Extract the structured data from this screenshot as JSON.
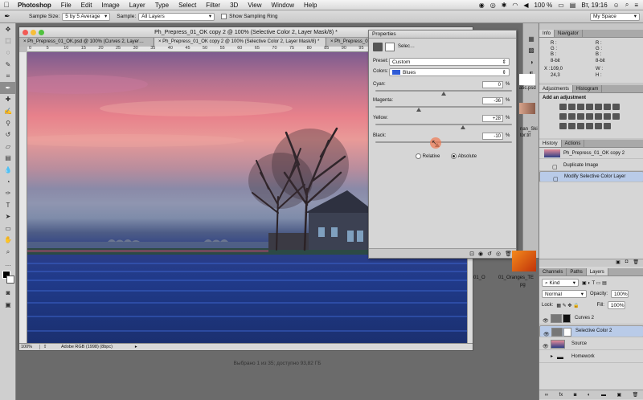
{
  "menubar": {
    "apple": "",
    "items": [
      "Photoshop",
      "File",
      "Edit",
      "Image",
      "Layer",
      "Type",
      "Select",
      "Filter",
      "3D",
      "View",
      "Window",
      "Help"
    ],
    "battery": "100 %",
    "clock": "Вт, 19:16"
  },
  "options": {
    "sample_size_label": "Sample Size:",
    "sample_size_value": "5 by 5 Average",
    "sample_label": "Sample:",
    "sample_value": "All Layers",
    "show_ring": "Show Sampling Ring",
    "workspace": "My Space"
  },
  "document": {
    "title": "Ph_Prepress_01_OK copy 2 @ 100% (Selective Color 2, Layer Mask/8) *",
    "tabs": [
      "Ph_Prepress_01_OK.psd @ 100% (Curves 2, Layer…",
      "Ph_Prepress_01_OK copy 2 @ 100% (Selective Color 2, Layer Mask/8) *",
      "Ph_Prepress_01_OK copy @ 100% (Layer/8)"
    ],
    "ruler_labels": [
      "0",
      "5",
      "10",
      "15",
      "20",
      "25",
      "30",
      "35",
      "40",
      "45",
      "50",
      "55",
      "60",
      "65",
      "70",
      "75",
      "80",
      "85",
      "90",
      "95",
      "100",
      "105",
      "110",
      "115",
      "120",
      "125"
    ],
    "zoom": "100%",
    "profile": "Adobe RGB (1998) (8bpc)"
  },
  "properties": {
    "title": "Properties",
    "panel_name": "Selec…",
    "preset_label": "Preset:",
    "preset_value": "Custom",
    "colors_label": "Colors:",
    "colors_value": "Blues",
    "colors_swatch": "#2f5bd6",
    "sliders": [
      {
        "label": "Cyan:",
        "value": "0",
        "pct": "%",
        "level": 0.5
      },
      {
        "label": "Magenta:",
        "value": "-36",
        "pct": "%",
        "level": 0.32
      },
      {
        "label": "Yellow:",
        "value": "+28",
        "pct": "%",
        "level": 0.64
      },
      {
        "label": "Black:",
        "value": "-10",
        "pct": "%",
        "level": 0.45
      }
    ],
    "relative": "Relative",
    "absolute": "Absolute",
    "method_selected": "Absolute"
  },
  "info_panel": {
    "tabs": [
      "Info",
      "Navigator"
    ],
    "r": "R :",
    "g": "G :",
    "b": "B :",
    "bits": "8-bit",
    "x": "X :",
    "x_value": "109,0",
    "y_value": "24,3",
    "w": "W :",
    "h": "H :"
  },
  "adjustments": {
    "tabs": [
      "Adjustments",
      "Histogram"
    ],
    "heading": "Add an adjustment"
  },
  "history": {
    "tabs": [
      "History",
      "Actions"
    ],
    "snapshot": "Ph_Prepress_01_OK copy 2",
    "items": [
      "Duplicate Image",
      "Modify Selective Color Layer"
    ]
  },
  "layers": {
    "tabs": [
      "Channels",
      "Paths",
      "Layers"
    ],
    "filter": "Kind",
    "blend": "Normal",
    "opacity_label": "Opacity:",
    "opacity_value": "100%",
    "lock_label": "Lock:",
    "fill_label": "Fill:",
    "fill_value": "100%",
    "rows": [
      "Curves 2",
      "Selective Color 2",
      "Source",
      "Homework"
    ]
  },
  "desktop": {
    "files": [
      "atic.psd",
      "nan_Ski",
      "tor.tif",
      "01_O",
      "01_Oranges_TE",
      "pg"
    ]
  },
  "finder_status": "Выбрано 1 из 35; доступно 93,82 ГБ"
}
